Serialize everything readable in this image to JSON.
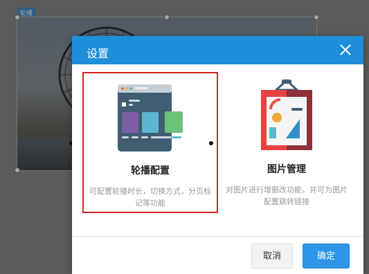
{
  "canvas": {
    "tag_label": "轮播"
  },
  "dialog": {
    "title": "设置",
    "cards": [
      {
        "title": "轮播配置",
        "description": "可配置轮播时长，切换方式，分页标记等功能",
        "selected": true
      },
      {
        "title": "图片管理",
        "description": "对图片进行增删改功能，并可为图片配置跳转链接",
        "selected": false
      }
    ],
    "cancel_label": "取消",
    "ok_label": "确定"
  },
  "colors": {
    "header": "#1e8ed8",
    "selection_border": "#d42020",
    "primary_button": "#2d96e8"
  }
}
